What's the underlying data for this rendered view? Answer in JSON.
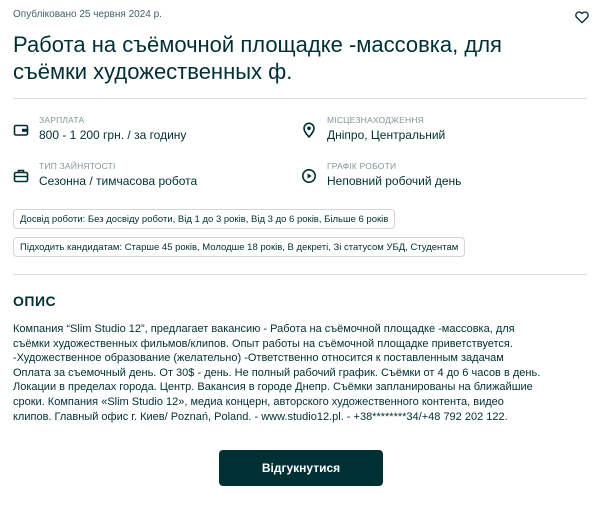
{
  "published": "Опубліковано 25 червня 2024 р.",
  "title": "Работа на съёмочной площадке -массовка, для съёмки художественных ф.",
  "meta": {
    "salary": {
      "label": "ЗАРПЛАТА",
      "value": "800 - 1 200 грн. / за годину",
      "icon": "wallet-icon"
    },
    "location": {
      "label": "МІСЦЕЗНАХОДЖЕННЯ",
      "value": "Дніпро, Центральний",
      "icon": "location-pin-icon"
    },
    "employment": {
      "label": "ТИП ЗАЙНЯТОСТІ",
      "value": "Сезонна / тимчасова робота",
      "icon": "briefcase-icon"
    },
    "schedule": {
      "label": "ГРАФІК РОБОТИ",
      "value": "Неповний робочий день",
      "icon": "play-clock-icon"
    }
  },
  "tags": {
    "experience": "Досвід роботи: Без досвіду роботи, Від 1 до 3 років, Від 3 до 6 років, Більше 6 років",
    "candidates": "Підходить кандидатам: Старше 45 років, Молодше 18 років, В декреті, Зі статусом УБД, Студентам"
  },
  "description": {
    "heading": "ОПИС",
    "text": "Компания “Slim Studio 12”, предлагает вакансию - Работа на съёмочной площадке -массовка, для\nсъёмки художественных фильмов/клипов. Опыт работы на съёмочной площадке приветствуется.\n-Художественное образование (желательно) -Ответственно относится к поставленным задачам\nОплата за съемочный день. От 30$ - день. Не полный рабочий график. Съёмки от 4 до 6 часов в день.\nЛокации в пределах города. Центр. Вакансия в городе Днепр. Съёмки запланированы на ближайшие\nсроки. Компания «Slim Studio 12», медиа концерн, авторского художественного контента, видео\nклипов. Главный офис г. Киев/ Poznań, Poland. - www.studio12.pl. - +38********34/+48 792 202 122."
  },
  "apply_label": "Відгукнутися",
  "colors": {
    "primary": "#002f34",
    "muted": "#7f9799",
    "border": "#cfd8d9"
  }
}
